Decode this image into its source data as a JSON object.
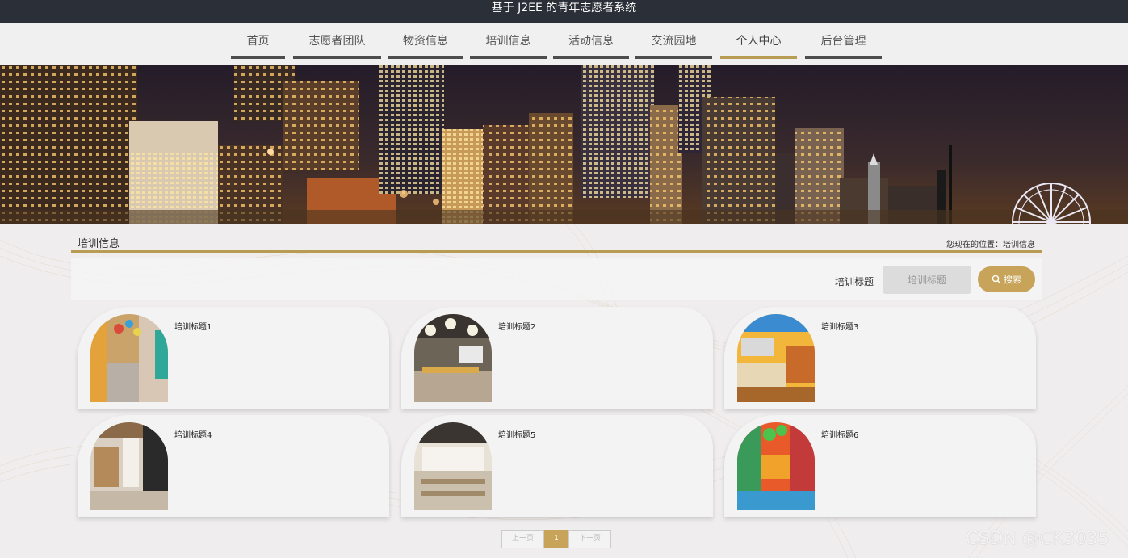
{
  "header": {
    "title": "基于 J2EE 的青年志愿者系统"
  },
  "nav": {
    "items": [
      {
        "label": "首页"
      },
      {
        "label": "志愿者团队"
      },
      {
        "label": "物资信息"
      },
      {
        "label": "培训信息"
      },
      {
        "label": "活动信息"
      },
      {
        "label": "交流园地"
      },
      {
        "label": "个人中心"
      },
      {
        "label": "后台管理"
      }
    ],
    "active": "个人中心"
  },
  "section": {
    "title": "培训信息",
    "location": "您现在的位置：培训信息"
  },
  "search": {
    "label": "培训标题",
    "placeholder": "培训标题",
    "button_label": "搜索"
  },
  "cards": [
    {
      "title": "培训标题1"
    },
    {
      "title": "培训标题2"
    },
    {
      "title": "培训标题3"
    },
    {
      "title": "培训标题4"
    },
    {
      "title": "培训标题5"
    },
    {
      "title": "培训标题6"
    }
  ],
  "pagination": {
    "prev": "上一页",
    "current": "1",
    "next": "下一页"
  },
  "watermark": "CSDN @CK3035",
  "colors": {
    "accent": "#c7a45a",
    "header_bg": "#2b2f38",
    "nav_underline": "#4d4d4d"
  }
}
